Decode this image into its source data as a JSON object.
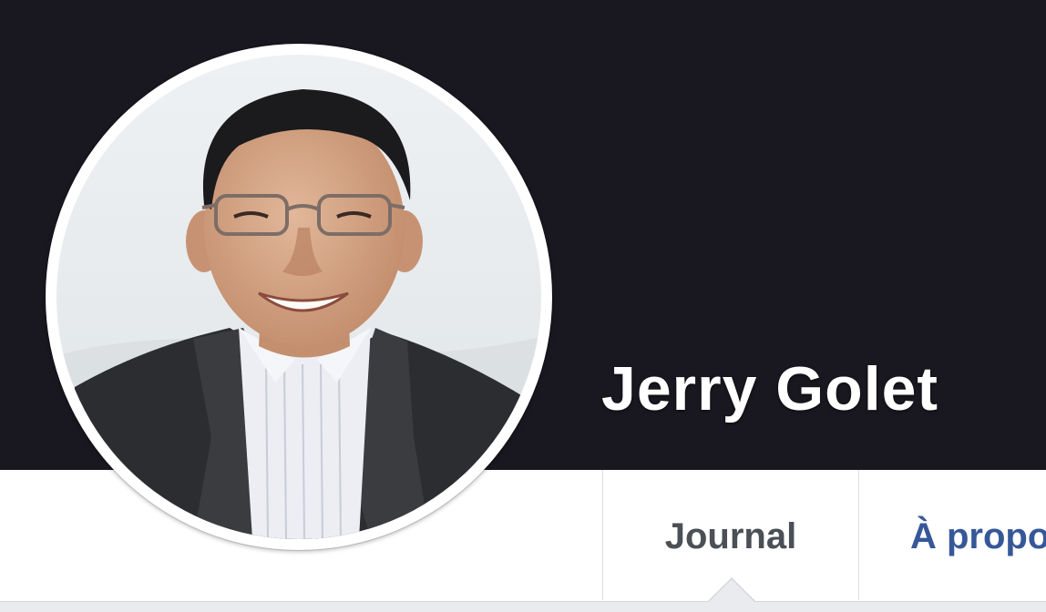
{
  "profile": {
    "name": "Jerry Golet",
    "avatar_alt": "Jerry Golet"
  },
  "nav": {
    "tabs": [
      {
        "label": "Journal",
        "active": true
      },
      {
        "label": "À propos",
        "active": false
      }
    ]
  },
  "colors": {
    "cover_background": "#19171f",
    "name_text": "#ffffff",
    "active_tab_text": "#4b4f56",
    "link_tab_text": "#365899",
    "page_background": "#e9ebee"
  }
}
